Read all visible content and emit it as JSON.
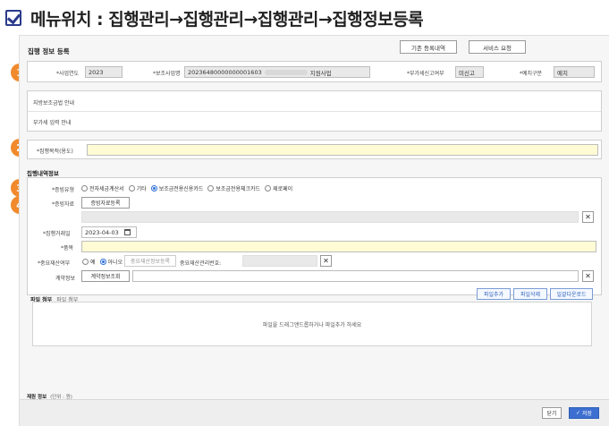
{
  "heading": {
    "text": "메뉴위치 : 집행관리→집행관리→집행관리→집행정보등록"
  },
  "window": {
    "title": "집행 정보 등록",
    "btn_history": "기존 등록내역",
    "btn_service": "서비스 요청"
  },
  "markers": [
    "1",
    "2",
    "3",
    "4"
  ],
  "basic": {
    "year_label": "*사업연도",
    "year_value": "2023",
    "biz_label": "*보조사업명",
    "biz_code": "20236480000000001603",
    "biz_suffix": "지원사업",
    "vat_label": "*부가세신고여부",
    "vat_value": "미신고",
    "deposit_label": "*예치구분",
    "deposit_value": "예치"
  },
  "notices": [
    "지방보조금법 안내",
    "부가세 입력 안내"
  ],
  "purpose": {
    "label": "*집행목적(용도)",
    "value": ""
  },
  "exec_section": "집행내역정보",
  "evidence_type": {
    "label": "*증빙유형",
    "options": [
      "전자세금계산서",
      "기타",
      "보조금전용신용카드",
      "보조금전용체크카드",
      "제로페이"
    ],
    "selected": "보조금전용신용카드"
  },
  "evidence_doc": {
    "label": "*증빙자료",
    "button": "증빙자료등록"
  },
  "exec_date": {
    "label": "*집행거래일",
    "value": "2023-04-03"
  },
  "item": {
    "label": "*품목",
    "value": ""
  },
  "important_asset": {
    "label": "*중요재산여부",
    "options": [
      "예",
      "아니오"
    ],
    "selected": "아니오",
    "btn": "중요재산정보등록",
    "mgmt_label": "중요재산관리번호:"
  },
  "contract": {
    "label": "계약정보",
    "button": "계약정보조회"
  },
  "attach": {
    "title": "파일 첨부",
    "subtitle": "파일 첨부",
    "btn_add": "파일추가",
    "btn_delete": "파일삭제",
    "btn_download": "일괄다운로드",
    "drop_hint": "파일을 드래그앤드롭하거나 파일추가 하세요"
  },
  "resource": {
    "title": "재원 정보",
    "unit": "(단위 : 원)"
  },
  "footer": {
    "close": "닫기",
    "save": "저장"
  },
  "colors": {
    "marker": "#f08a2c",
    "required_field": "#fffbd4",
    "primary": "#3c6fd0"
  }
}
